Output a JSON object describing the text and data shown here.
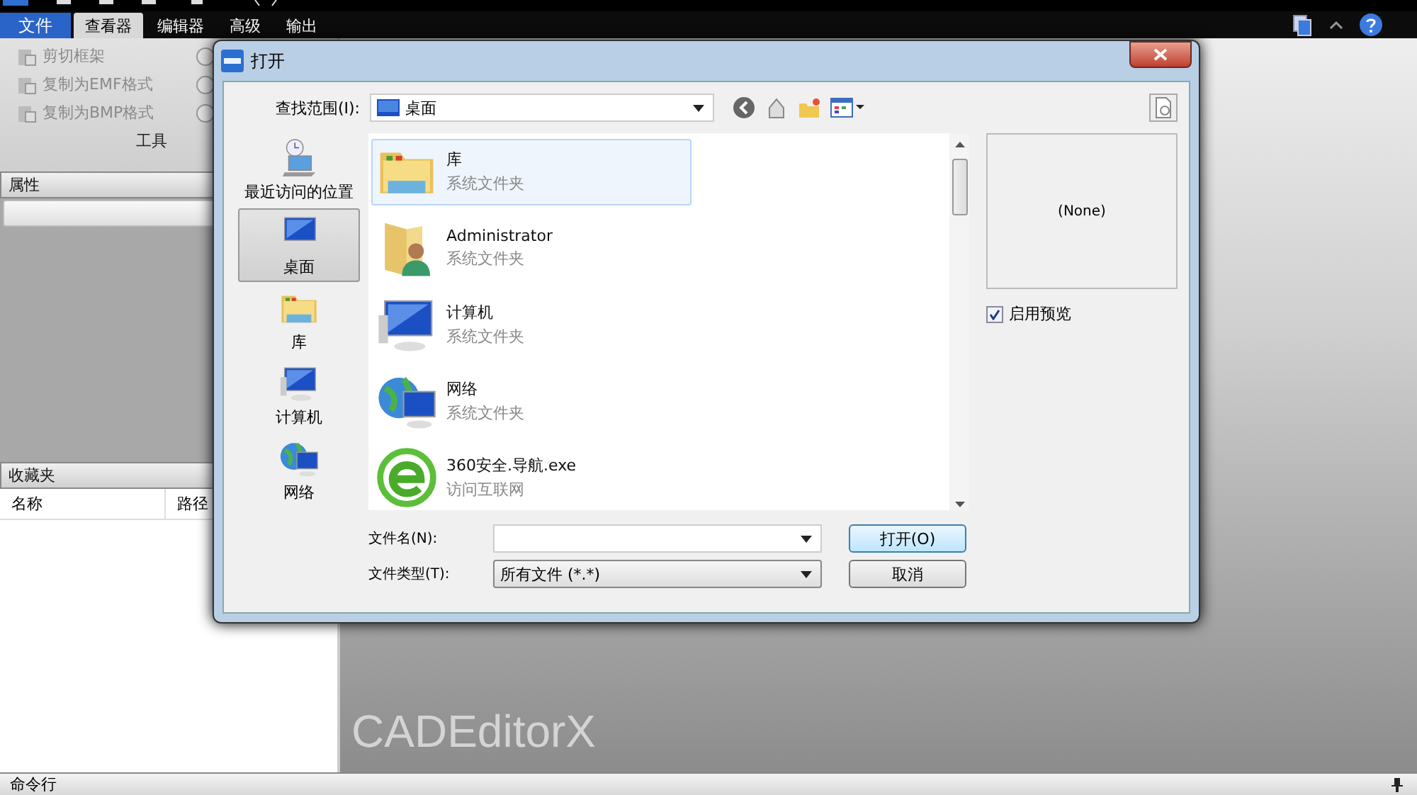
{
  "app": {
    "file_menu": "文件",
    "tabs": [
      {
        "label": "查看器",
        "selected": true
      },
      {
        "label": "编辑器",
        "selected": false
      },
      {
        "label": "高级",
        "selected": false
      },
      {
        "label": "输出",
        "selected": false
      }
    ],
    "ribbon": {
      "tools": [
        {
          "label": "剪切框架",
          "disabled": true
        },
        {
          "label": "复制为EMF格式",
          "disabled": true
        },
        {
          "label": "复制为BMP格式",
          "disabled": true
        }
      ],
      "group_label": "工具"
    },
    "properties_panel": {
      "title": "属性"
    },
    "favorites_panel": {
      "title": "收藏夹",
      "columns": [
        "名称",
        "路径"
      ]
    },
    "canvas": {
      "logo": "CADEditorX"
    },
    "command_bar": {
      "title": "命令行"
    }
  },
  "dialog": {
    "title": "打开",
    "look_in": {
      "label": "查找范围(I):",
      "value": "桌面"
    },
    "places": [
      {
        "label": "最近访问的位置",
        "selected": false
      },
      {
        "label": "桌面",
        "selected": true
      },
      {
        "label": "库",
        "selected": false
      },
      {
        "label": "计算机",
        "selected": false
      },
      {
        "label": "网络",
        "selected": false
      }
    ],
    "files": [
      {
        "name": "库",
        "description": "系统文件夹",
        "selected": true
      },
      {
        "name": "Administrator",
        "description": "系统文件夹",
        "selected": false
      },
      {
        "name": "计算机",
        "description": "系统文件夹",
        "selected": false
      },
      {
        "name": "网络",
        "description": "系统文件夹",
        "selected": false
      },
      {
        "name": "360安全.导航.exe",
        "description": "访问互联网",
        "selected": false
      }
    ],
    "preview": {
      "text": "(None)",
      "enable_label": "启用预览",
      "checked": true
    },
    "file_name": {
      "label": "文件名(N):"
    },
    "file_type": {
      "label": "文件类型(T):",
      "value": "所有文件 (*.*)"
    },
    "buttons": [
      "打开(O)",
      "取消"
    ]
  }
}
